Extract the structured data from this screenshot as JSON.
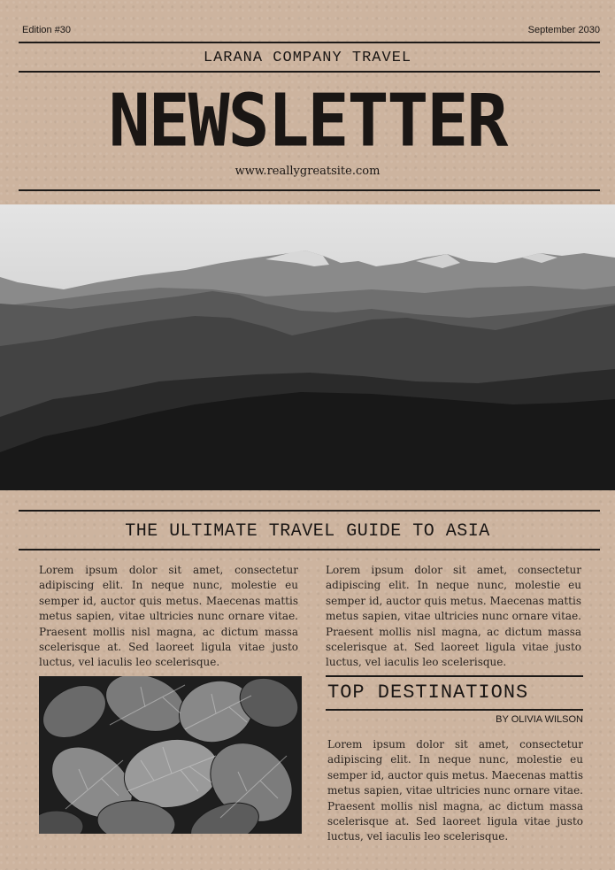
{
  "header": {
    "edition": "Edition #30",
    "date": "September 2030",
    "company": "LARANA COMPANY TRAVEL",
    "title": "NEWSLETTER",
    "website": "www.reallygreatsite.com"
  },
  "article": {
    "headline": "THE ULTIMATE TRAVEL GUIDE TO ASIA",
    "col1": "Lorem ipsum dolor sit amet, consectetur adipiscing elit. In neque nunc, molestie eu semper id, auctor quis metus. Maecenas mattis metus sapien, vitae ultricies nunc ornare vitae. Praesent mollis nisl magna, ac dictum massa scelerisque at. Sed laoreet ligula vitae justo luctus, vel iaculis leo scelerisque.",
    "col2": "Lorem ipsum dolor sit amet, consectetur adipiscing elit. In neque nunc, molestie eu semper id, auctor quis metus. Maecenas mattis metus sapien, vitae ultricies nunc ornare vitae. Praesent mollis nisl magna, ac dictum massa scelerisque at. Sed laoreet ligula vitae justo luctus, vel iaculis leo scelerisque."
  },
  "destinations": {
    "heading": "TOP DESTINATIONS",
    "byline": "BY OLIVIA WILSON",
    "body": "Lorem ipsum dolor sit amet, consectetur adipiscing elit. In neque nunc, molestie eu semper id, auctor quis metus. Maecenas mattis metus sapien, vitae ultricies nunc ornare vitae. Praesent mollis nisl magna, ac dictum massa scelerisque at. Sed laoreet ligula vitae justo luctus, vel iaculis leo scelerisque."
  },
  "colors": {
    "paper": "#cdb49f",
    "ink": "#1d1a18"
  }
}
